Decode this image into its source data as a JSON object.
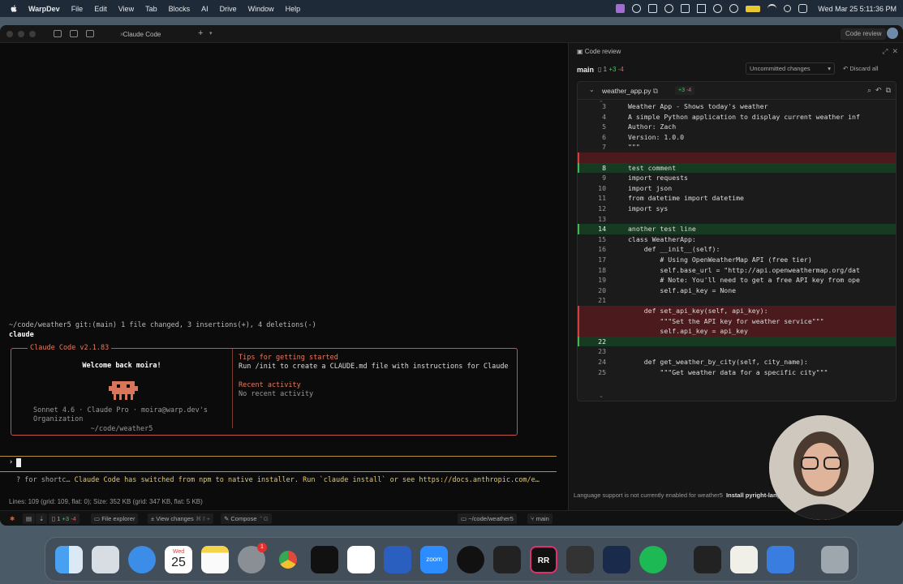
{
  "menubar": {
    "app": "WarpDev",
    "items": [
      "File",
      "Edit",
      "View",
      "Tab",
      "Blocks",
      "AI",
      "Drive",
      "Window",
      "Help"
    ],
    "clock": "Wed Mar 25  5:11:36 PM"
  },
  "window": {
    "tab_title": "Claude Code",
    "code_review_button": "Code review"
  },
  "terminal": {
    "prompt_path": "~/code/weather5 git:(main)  1 file changed, 3 insertions(+), 4 deletions(-)",
    "command": "claude",
    "box_title": "Claude Code v2.1.83",
    "welcome": "Welcome back moira!",
    "model_line": "Sonnet 4.6 · Claude Pro · moira@warp.dev's Organization",
    "cwd": "~/code/weather5",
    "tips_heading": "Tips for getting started",
    "tips_body": "Run /init to create a CLAUDE.md file with instructions for Claude",
    "recent_heading": "Recent activity",
    "recent_body": "No recent activity",
    "caret": "›",
    "notice_prefix": "? for shortc…",
    "notice_text": "Claude Code has switched from npm to native installer. Run `claude install` or see https://docs.anthropic.com/e…",
    "stats": "Lines: 109 (grid: 109, flat: 0); Size: 352 KB (grid: 347 KB, flat: 5 KB)"
  },
  "statusbar": {
    "counts": "1",
    "plus": "+3",
    "minus": "-4",
    "file_explorer": "File explorer",
    "view_changes": "View changes",
    "view_changes_kbd": "⌘⇧+",
    "compose": "Compose",
    "compose_kbd": "⌃G",
    "path": "~/code/weather5",
    "branch": "main"
  },
  "panel": {
    "title": "Code review",
    "branch": "main",
    "count": "1",
    "plus": "+3",
    "minus": "-4",
    "uncommitted": "Uncommitted changes",
    "discard": "Discard all",
    "file": "weather_app.py",
    "file_plus": "+3",
    "file_minus": "-4",
    "lang_notice": "Language support is not currently enabled for weather5",
    "lang_action": "Install pyright-langserver"
  },
  "code": [
    {
      "n": "3",
      "t": "Weather App - Shows today's weather",
      "k": "cm",
      "s": ""
    },
    {
      "n": "4",
      "t": "A simple Python application to display current weather inf",
      "k": "cm",
      "s": ""
    },
    {
      "n": "5",
      "t": "Author: Zach",
      "k": "cm",
      "s": ""
    },
    {
      "n": "6",
      "t": "Version: 1.0.0",
      "k": "cm",
      "s": ""
    },
    {
      "n": "7",
      "t": "\"\"\"",
      "k": "cm",
      "s": ""
    },
    {
      "n": "",
      "t": "",
      "k": "",
      "s": "del"
    },
    {
      "n": "8",
      "t": "test comment",
      "k": "cm",
      "s": "add"
    },
    {
      "n": "9",
      "t": "import requests",
      "k": "",
      "s": ""
    },
    {
      "n": "10",
      "t": "import json",
      "k": "",
      "s": ""
    },
    {
      "n": "11",
      "t": "from datetime import datetime",
      "k": "",
      "s": ""
    },
    {
      "n": "12",
      "t": "import sys",
      "k": "",
      "s": ""
    },
    {
      "n": "13",
      "t": "",
      "k": "",
      "s": ""
    },
    {
      "n": "14",
      "t": "another test line",
      "k": "",
      "s": "add"
    },
    {
      "n": "15",
      "t": "class WeatherApp:",
      "k": "",
      "s": ""
    },
    {
      "n": "16",
      "t": "    def __init__(self):",
      "k": "",
      "s": ""
    },
    {
      "n": "17",
      "t": "        # Using OpenWeatherMap API (free tier)",
      "k": "str",
      "s": ""
    },
    {
      "n": "18",
      "t": "        self.base_url = \"http://api.openweathermap.org/dat",
      "k": "",
      "s": ""
    },
    {
      "n": "19",
      "t": "        # Note: You'll need to get a free API key from ope",
      "k": "str",
      "s": ""
    },
    {
      "n": "20",
      "t": "        self.api_key = None",
      "k": "",
      "s": ""
    },
    {
      "n": "21",
      "t": "",
      "k": "",
      "s": ""
    },
    {
      "n": "",
      "t": "    def set_api_key(self, api_key):",
      "k": "",
      "s": "del"
    },
    {
      "n": "",
      "t": "        \"\"\"Set the API key for weather service\"\"\"",
      "k": "",
      "s": "del"
    },
    {
      "n": "",
      "t": "        self.api_key = api_key",
      "k": "",
      "s": "del"
    },
    {
      "n": "22",
      "t": "",
      "k": "",
      "s": "add"
    },
    {
      "n": "23",
      "t": "",
      "k": "",
      "s": ""
    },
    {
      "n": "24",
      "t": "    def get_weather_by_city(self, city_name):",
      "k": "fn",
      "s": ""
    },
    {
      "n": "25",
      "t": "        \"\"\"Get weather data for a specific city\"\"\"",
      "k": "str",
      "s": ""
    }
  ],
  "dock": {
    "calendar_month": "Wed",
    "calendar_day": "25",
    "badge": "1",
    "zoom": "zoom",
    "rr": "RR"
  }
}
